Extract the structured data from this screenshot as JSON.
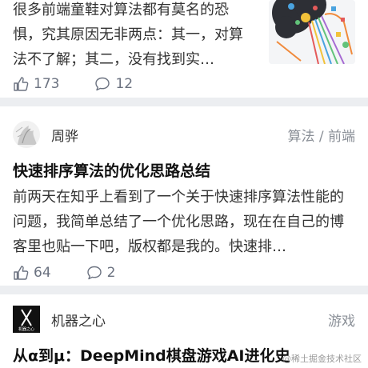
{
  "articles": [
    {
      "excerpt": "很多前端童鞋对算法都有莫名的恐惧，究其原因无非两点：其一，对算法不了解；其二，没有找到实…",
      "likes": "173",
      "comments": "12"
    },
    {
      "author": "周骅",
      "tags": "算法 / 前端",
      "title": "快速排序算法的优化思路总结",
      "excerpt": "前两天在知乎上看到了一个关于快速排序算法性能的问题，我简单总结了一个优化思路，现在在自己的博客里也贴一下吧，版权都是我的。快速排…",
      "likes": "64",
      "comments": "2"
    },
    {
      "author": "机器之心",
      "avatar_text": "机器之心",
      "tags": "游戏",
      "title": "从α到μ：DeepMind棋盘游戏AI进化史"
    }
  ],
  "watermark": "@稀土掘金技术社区",
  "colors": {
    "accent": "#8a8f97",
    "background": "#eceef1",
    "card": "#ffffff"
  },
  "icons": [
    "thumbs-up-icon",
    "comment-icon"
  ]
}
